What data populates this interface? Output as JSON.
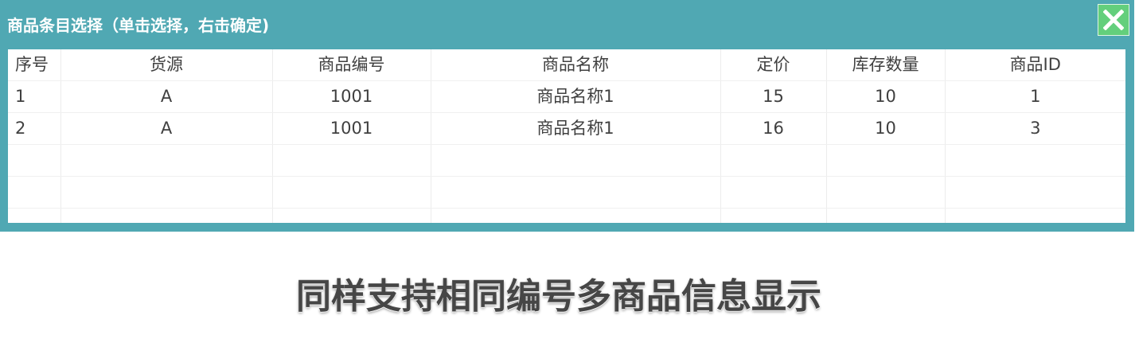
{
  "dialog": {
    "title": "商品条目选择（单击选择，右击确定)",
    "close_icon": "close-icon",
    "accent_color": "#50a8b3",
    "close_color": "#63cf7c"
  },
  "table": {
    "columns": [
      "序号",
      "货源",
      "商品编号",
      "商品名称",
      "定价",
      "库存数量",
      "商品ID"
    ],
    "rows": [
      [
        "1",
        "A",
        "1001",
        "商品名称1",
        "15",
        "10",
        "1"
      ],
      [
        "2",
        "A",
        "1001",
        "商品名称1",
        "16",
        "10",
        "3"
      ]
    ]
  },
  "caption": "同样支持相同编号多商品信息显示"
}
